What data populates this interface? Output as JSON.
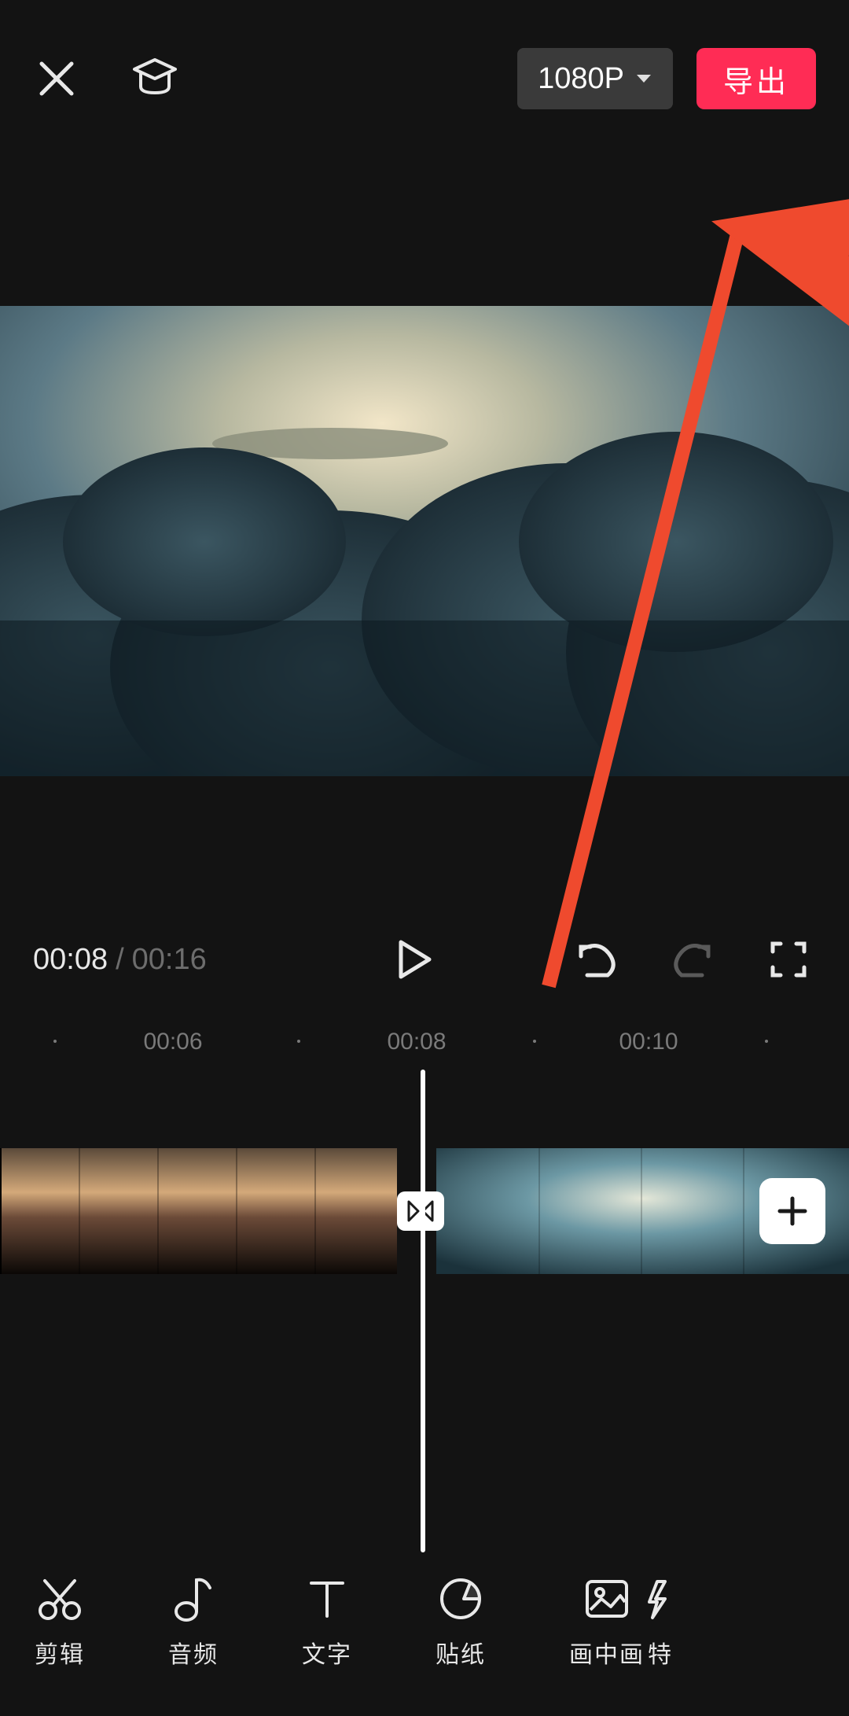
{
  "topbar": {
    "resolution": "1080P",
    "export": "导出"
  },
  "playback": {
    "current": "00:08",
    "separator": "/",
    "total": "00:16"
  },
  "ruler": [
    "00:06",
    "00:08",
    "00:10"
  ],
  "toolbar": [
    "剪辑",
    "音频",
    "文字",
    "贴纸",
    "画中画",
    "特"
  ],
  "annotation": {
    "arrow_color": "#ef4a2e",
    "points_from": "timeline",
    "points_to": "export-button"
  },
  "colors": {
    "background": "#131313",
    "accent": "#ff2c55",
    "text_primary": "#e8e8e8",
    "text_secondary": "#6d6d6d",
    "button_grey": "#3a3a3a"
  }
}
